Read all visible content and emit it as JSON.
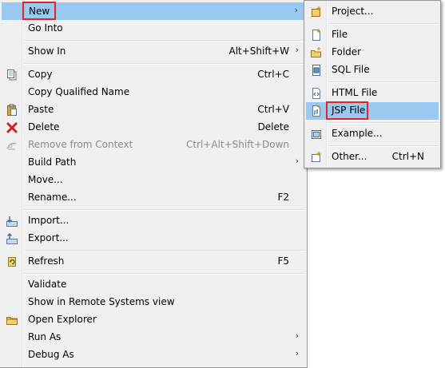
{
  "main_menu": {
    "items": [
      {
        "label": "New",
        "shortcut": "",
        "submenu": true
      },
      {
        "label": "Go Into",
        "shortcut": "",
        "submenu": false
      },
      {
        "label": "Show In",
        "shortcut": "Alt+Shift+W",
        "submenu": true
      },
      {
        "label": "Copy",
        "shortcut": "Ctrl+C",
        "submenu": false
      },
      {
        "label": "Copy Qualified Name",
        "shortcut": "",
        "submenu": false
      },
      {
        "label": "Paste",
        "shortcut": "Ctrl+V",
        "submenu": false
      },
      {
        "label": "Delete",
        "shortcut": "Delete",
        "submenu": false
      },
      {
        "label": "Remove from Context",
        "shortcut": "Ctrl+Alt+Shift+Down",
        "submenu": false,
        "disabled": true
      },
      {
        "label": "Build Path",
        "shortcut": "",
        "submenu": true
      },
      {
        "label": "Move...",
        "shortcut": "",
        "submenu": false
      },
      {
        "label": "Rename...",
        "shortcut": "F2",
        "submenu": false
      },
      {
        "label": "Import...",
        "shortcut": "",
        "submenu": false
      },
      {
        "label": "Export...",
        "shortcut": "",
        "submenu": false
      },
      {
        "label": "Refresh",
        "shortcut": "F5",
        "submenu": false
      },
      {
        "label": "Validate",
        "shortcut": "",
        "submenu": false
      },
      {
        "label": "Show in Remote Systems view",
        "shortcut": "",
        "submenu": false
      },
      {
        "label": "Open Explorer",
        "shortcut": "",
        "submenu": false
      },
      {
        "label": "Run As",
        "shortcut": "",
        "submenu": true
      },
      {
        "label": "Debug As",
        "shortcut": "",
        "submenu": true
      }
    ],
    "arrow_glyph": "›"
  },
  "sub_menu": {
    "items": [
      {
        "label": "Project...",
        "shortcut": ""
      },
      {
        "label": "File",
        "shortcut": ""
      },
      {
        "label": "Folder",
        "shortcut": ""
      },
      {
        "label": "SQL File",
        "shortcut": ""
      },
      {
        "label": "HTML File",
        "shortcut": ""
      },
      {
        "label": "JSP File",
        "shortcut": ""
      },
      {
        "label": "Example...",
        "shortcut": ""
      },
      {
        "label": "Other...",
        "shortcut": "Ctrl+N"
      }
    ]
  },
  "colors": {
    "menu_bg": "#f0f0f0",
    "highlight": "#99c9ef",
    "callout_red": "#e0252a",
    "disabled_text": "#8b8b8b"
  },
  "icons": {
    "copy": "copy-icon",
    "paste": "paste-icon",
    "delete": "delete-icon",
    "remove_from_context": "remove-context-icon",
    "import": "import-icon",
    "export": "export-icon",
    "refresh": "refresh-icon",
    "open_explorer": "folder-icon",
    "project": "new-project-icon",
    "file": "file-icon",
    "folder": "folder-icon",
    "sql_file": "sql-file-icon",
    "html_file": "html-file-icon",
    "jsp_file": "jsp-file-icon",
    "example": "example-icon",
    "other": "new-wizard-icon"
  }
}
